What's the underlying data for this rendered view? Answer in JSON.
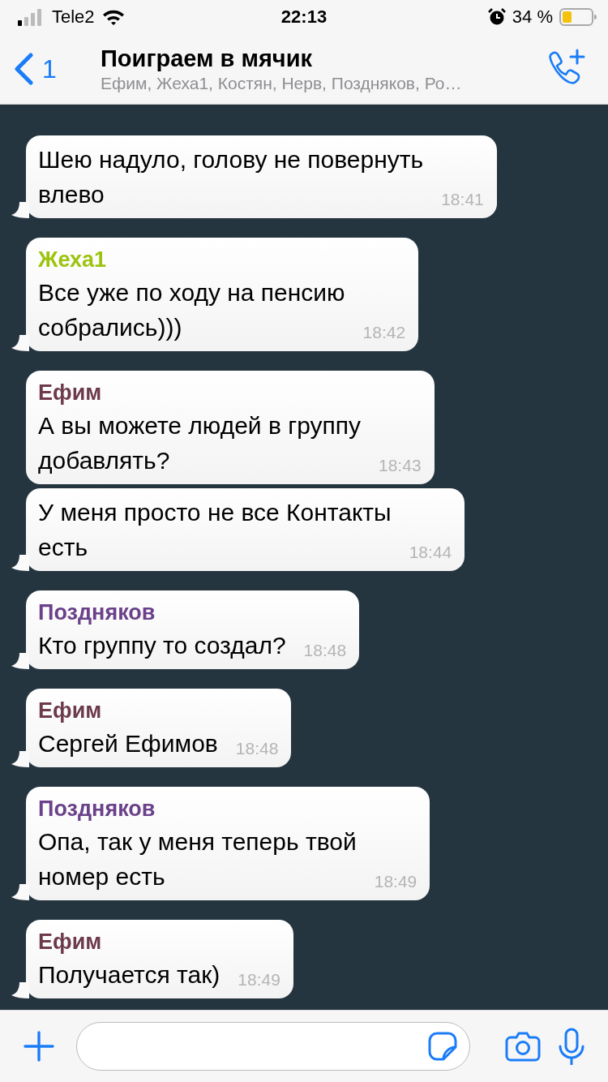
{
  "status_bar": {
    "carrier": "Tele2",
    "time": "22:13",
    "battery": "34 %"
  },
  "header": {
    "back_count": "1",
    "title": "Поиграем в мячик",
    "subtitle": "Ефим, Жеха1, Костян, Нерв, Поздняков, Ро…"
  },
  "messages": [
    {
      "text": "Шею надуло, голову не повернуть\nвлево",
      "time": "18:41",
      "tail": true
    },
    {
      "sender": "Жеха1",
      "color": "#9dc30f",
      "text": "Все уже по ходу на пенсию\nсобрались)))",
      "time": "18:42",
      "tail": true
    },
    {
      "sender": "Ефим",
      "color": "#6d3a4b",
      "text": "А вы можете людей в группу\nдобавлять?",
      "time": "18:43",
      "tail": false
    },
    {
      "text": "У меня просто не все Контакты\nесть",
      "time": "18:44",
      "tail": true
    },
    {
      "sender": "Поздняков",
      "color": "#6a418a",
      "text": "Кто группу то создал?",
      "time": "18:48",
      "tail": true
    },
    {
      "sender": "Ефим",
      "color": "#6d3a4b",
      "text": "Сергей Ефимов",
      "time": "18:48",
      "tail": true
    },
    {
      "sender": "Поздняков",
      "color": "#6a418a",
      "text": "Опа, так у меня теперь твой\nномер есть",
      "time": "18:49",
      "tail": true
    },
    {
      "sender": "Ефим",
      "color": "#6d3a4b",
      "text": "Получается так)",
      "time": "18:49",
      "tail": true
    }
  ]
}
